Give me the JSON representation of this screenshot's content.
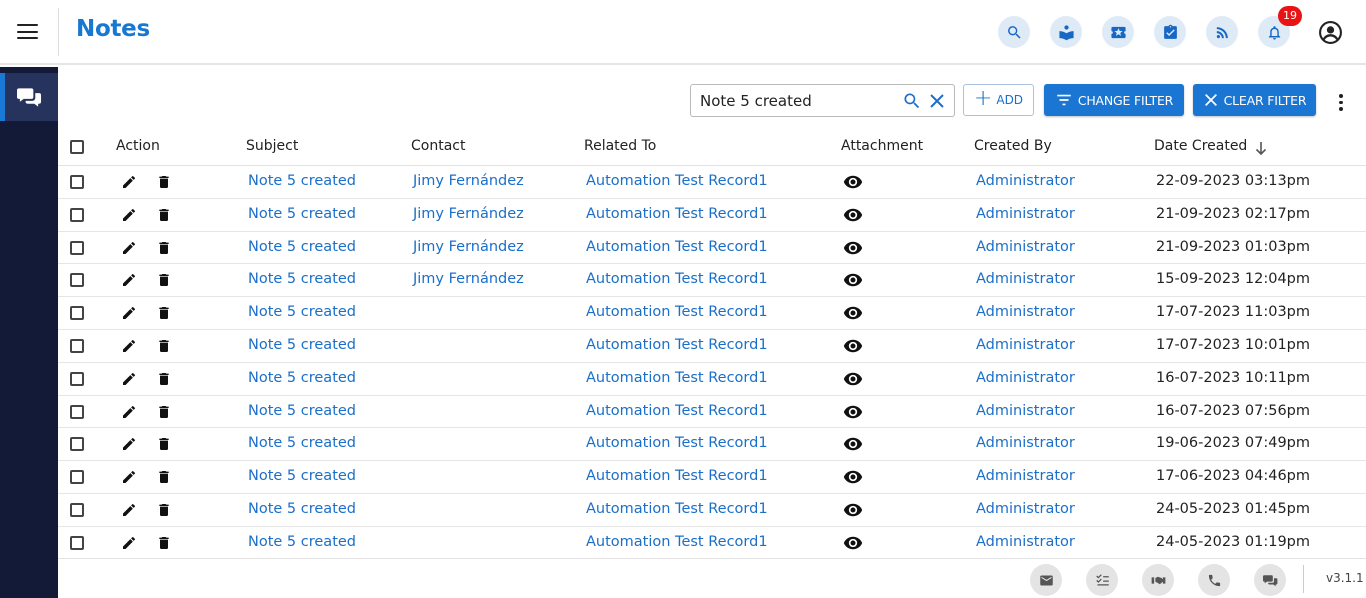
{
  "header": {
    "title": "Notes",
    "notification_count": "19",
    "icons": [
      "search-icon",
      "knowledge-icon",
      "ticket-icon",
      "task-icon",
      "rss-icon",
      "bell-icon",
      "profile-icon"
    ]
  },
  "sidebar": {
    "items": [
      {
        "name": "chat-icon",
        "active": true
      }
    ]
  },
  "toolbar": {
    "search_value": "Note 5 created",
    "add_label": "ADD",
    "change_filter_label": "CHANGE FILTER",
    "clear_filter_label": "CLEAR FILTER"
  },
  "table": {
    "columns": [
      "Action",
      "Subject",
      "Contact",
      "Related To",
      "Attachment",
      "Created By",
      "Date Created"
    ],
    "rows": [
      {
        "subject": "Note 5 created",
        "contact": "Jimy Fernández",
        "related": "Automation Test Record1",
        "created_by": "Administrator",
        "date": "22-09-2023 03:13pm"
      },
      {
        "subject": "Note 5 created",
        "contact": "Jimy Fernández",
        "related": "Automation Test Record1",
        "created_by": "Administrator",
        "date": "21-09-2023 02:17pm"
      },
      {
        "subject": "Note 5 created",
        "contact": "Jimy Fernández",
        "related": "Automation Test Record1",
        "created_by": "Administrator",
        "date": "21-09-2023 01:03pm"
      },
      {
        "subject": "Note 5 created",
        "contact": "Jimy Fernández",
        "related": "Automation Test Record1",
        "created_by": "Administrator",
        "date": "15-09-2023 12:04pm"
      },
      {
        "subject": "Note 5 created",
        "contact": "",
        "related": "Automation Test Record1",
        "created_by": "Administrator",
        "date": "17-07-2023 11:03pm"
      },
      {
        "subject": "Note 5 created",
        "contact": "",
        "related": "Automation Test Record1",
        "created_by": "Administrator",
        "date": "17-07-2023 10:01pm"
      },
      {
        "subject": "Note 5 created",
        "contact": "",
        "related": "Automation Test Record1",
        "created_by": "Administrator",
        "date": "16-07-2023 10:11pm"
      },
      {
        "subject": "Note 5 created",
        "contact": "",
        "related": "Automation Test Record1",
        "created_by": "Administrator",
        "date": "16-07-2023 07:56pm"
      },
      {
        "subject": "Note 5 created",
        "contact": "",
        "related": "Automation Test Record1",
        "created_by": "Administrator",
        "date": "19-06-2023 07:49pm"
      },
      {
        "subject": "Note 5 created",
        "contact": "",
        "related": "Automation Test Record1",
        "created_by": "Administrator",
        "date": "17-06-2023 04:46pm"
      },
      {
        "subject": "Note 5 created",
        "contact": "",
        "related": "Automation Test Record1",
        "created_by": "Administrator",
        "date": "24-05-2023 01:45pm"
      },
      {
        "subject": "Note 5 created",
        "contact": "",
        "related": "Automation Test Record1",
        "created_by": "Administrator",
        "date": "24-05-2023 01:19pm"
      }
    ]
  },
  "footer": {
    "icons": [
      "email-icon",
      "checklist-icon",
      "meeting-icon",
      "phone-icon",
      "chat-icon"
    ],
    "version": "v3.1.1"
  },
  "colors": {
    "brand_blue": "#1a76d2",
    "link_blue": "#1b6fc9",
    "sidebar_bg": "#121a37",
    "badge_red": "#e81414"
  }
}
